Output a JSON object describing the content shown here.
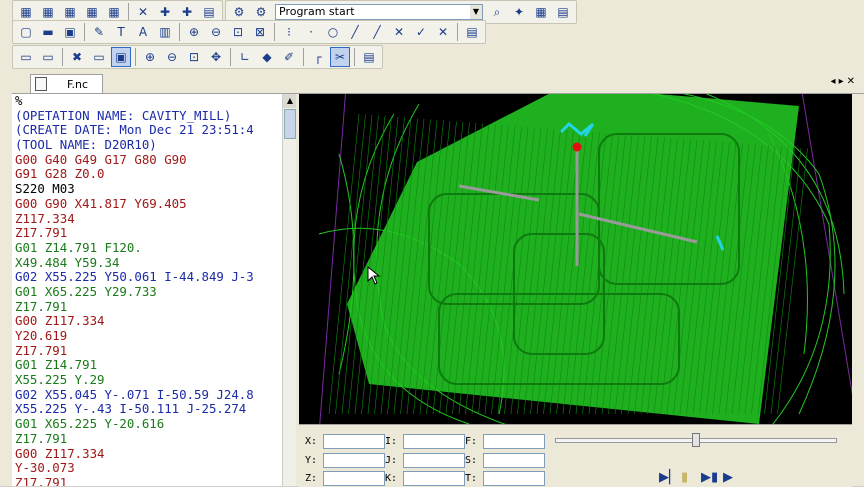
{
  "toolbar": {
    "program_combo": {
      "value": "Program start"
    }
  },
  "tab": {
    "label": "F.nc"
  },
  "editor": {
    "lines": [
      {
        "text": "%",
        "color": "#000000"
      },
      {
        "text": "(OPETATION NAME: CAVITY_MILL)",
        "color": "#1b2aa8"
      },
      {
        "text": "(CREATE DATE: Mon Dec 21 23:51:4",
        "color": "#1b2aa8"
      },
      {
        "text": "(TOOL NAME: D20R10)",
        "color": "#1b2aa8"
      },
      {
        "text": "G00 G40 G49 G17 G80 G90",
        "color": "#a01818"
      },
      {
        "text": "G91 G28 Z0.0",
        "color": "#a01818"
      },
      {
        "text": "S220 M03",
        "color": "#000000"
      },
      {
        "text": "G00 G90 X41.817 Y69.405",
        "color": "#a01818"
      },
      {
        "text": "Z117.334",
        "color": "#a01818"
      },
      {
        "text": "Z17.791",
        "color": "#a01818"
      },
      {
        "text": "G01 Z14.791 F120.",
        "color": "#1a7a1a"
      },
      {
        "text": "X49.484 Y59.34",
        "color": "#1a7a1a"
      },
      {
        "text": "G02 X55.225 Y50.061 I-44.849 J-3",
        "color": "#1b2aa8"
      },
      {
        "text": "G01 X65.225 Y29.733",
        "color": "#1a7a1a"
      },
      {
        "text": "Z17.791",
        "color": "#1a7a1a"
      },
      {
        "text": "G00 Z117.334",
        "color": "#a01818"
      },
      {
        "text": "Y20.619",
        "color": "#a01818"
      },
      {
        "text": "Z17.791",
        "color": "#a01818"
      },
      {
        "text": "G01 Z14.791",
        "color": "#1a7a1a"
      },
      {
        "text": "X55.225 Y.29",
        "color": "#1a7a1a"
      },
      {
        "text": "G02 X55.045 Y-.071 I-50.59 J24.8",
        "color": "#1b2aa8"
      },
      {
        "text": "X55.225 Y-.43 I-50.111 J-25.274",
        "color": "#1b2aa8"
      },
      {
        "text": "G01 X65.225 Y-20.616",
        "color": "#1a7a1a"
      },
      {
        "text": "Z17.791",
        "color": "#1a7a1a"
      },
      {
        "text": "G00 Z117.334",
        "color": "#a01818"
      },
      {
        "text": "Y-30.073",
        "color": "#a01818"
      },
      {
        "text": "Z17.791",
        "color": "#a01818"
      }
    ]
  },
  "coords": {
    "x_label": "X:",
    "y_label": "Y:",
    "z_label": "Z:",
    "i_label": "I:",
    "j_label": "J:",
    "k_label": "K:",
    "f_label": "F:",
    "s_label": "S:",
    "t_label": "T:"
  },
  "playback": {
    "progress": 0.5,
    "play_icon": "play-step-icon",
    "pause_icon": "pause-icon",
    "skip_icon": "skip-forward-icon",
    "end_icon": "play-icon"
  },
  "colors": {
    "toolpath": "#22c822",
    "viewport_bg": "#000000",
    "tool_marker": "#e01010",
    "stock_border": "#7a2aa0"
  }
}
